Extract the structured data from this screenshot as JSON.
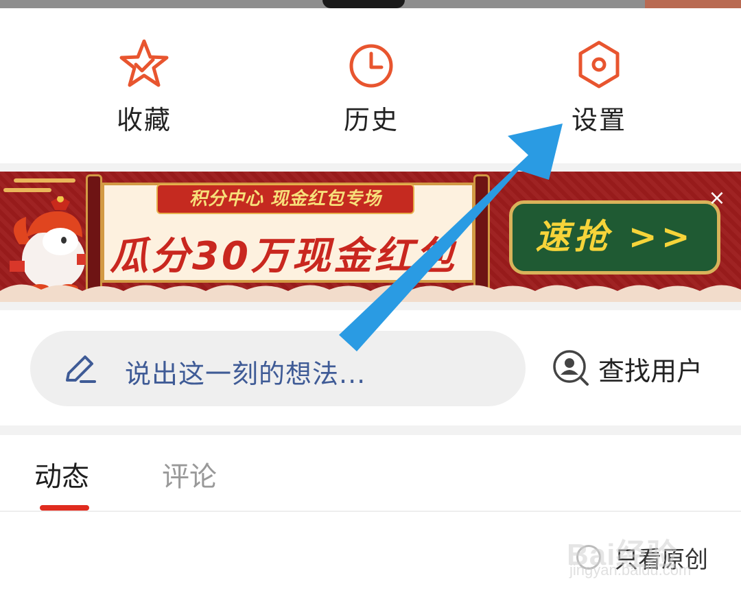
{
  "quick_actions": [
    {
      "label": "收藏",
      "icon": "star-check-icon"
    },
    {
      "label": "历史",
      "icon": "clock-icon"
    },
    {
      "label": "设置",
      "icon": "hexagon-gear-icon"
    }
  ],
  "banner": {
    "badge": "积分中心 现金红包专场",
    "headline": "瓜分30万现金红包",
    "cta": "速抢 >>",
    "close": "×"
  },
  "post": {
    "placeholder": "说出这一刻的想法...",
    "find_user": "查找用户"
  },
  "tabs": [
    {
      "label": "动态",
      "active": true
    },
    {
      "label": "评论",
      "active": false
    }
  ],
  "filter": {
    "label": "只看原创"
  },
  "watermark": {
    "line1": "Bai经验",
    "line2": "jingyan.baidu.com"
  },
  "colors": {
    "accent": "#e02c1f",
    "icon_orange": "#e8552f",
    "arrow_blue": "#2a9be3",
    "banner_red": "#9c1c1c",
    "placeholder_blue": "#3f5b96"
  }
}
